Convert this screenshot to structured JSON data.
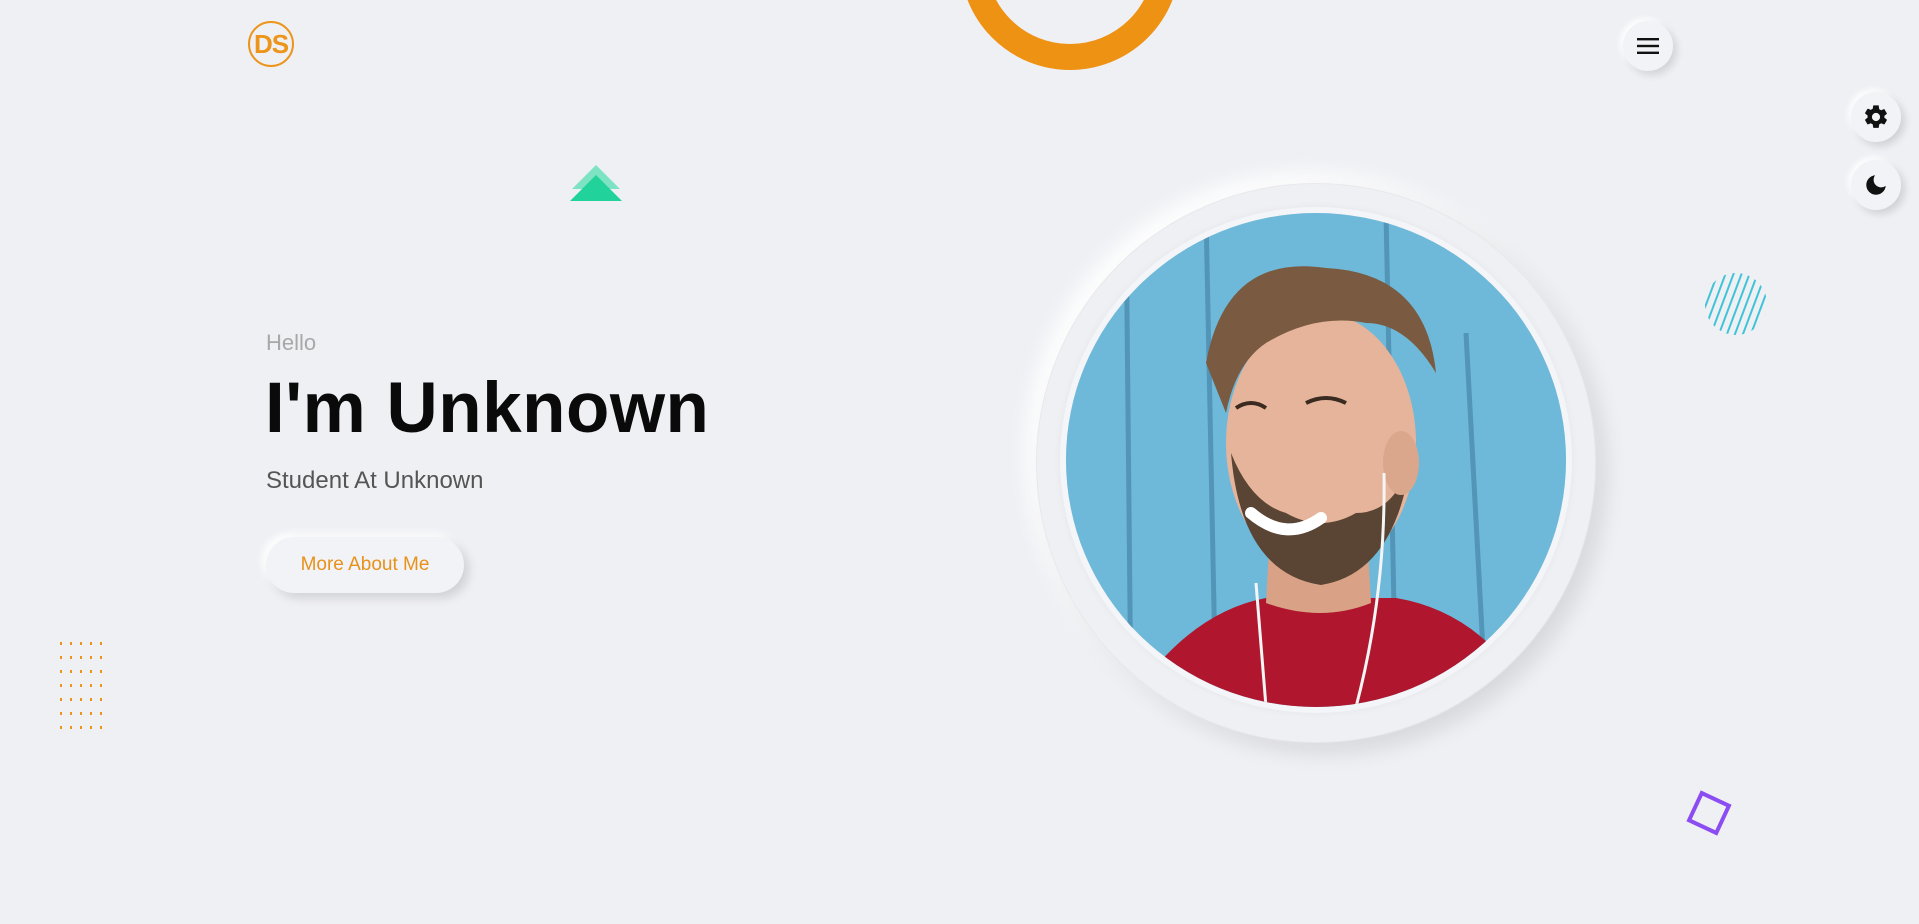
{
  "logo": {
    "text": "DS",
    "color": "#ec951a"
  },
  "nav": {
    "menu_icon": "hamburger-icon"
  },
  "side_controls": [
    {
      "name": "settings",
      "icon": "gear-icon"
    },
    {
      "name": "theme-toggle",
      "icon": "moon-icon"
    }
  ],
  "hero": {
    "greeting": "Hello",
    "title": "I'm Unknown",
    "subtitle": "Student At Unknown",
    "cta_label": "More About Me"
  },
  "colors": {
    "accent": "#ec951a",
    "background": "#eff0f4",
    "teal": "#2fd3a0",
    "cyan": "#3fc3d8",
    "purple": "#8b4cf1"
  },
  "decorations": [
    "ring",
    "teal-triangles",
    "cyan-hatched-circle",
    "orange-dot-grid",
    "purple-square-outline"
  ]
}
